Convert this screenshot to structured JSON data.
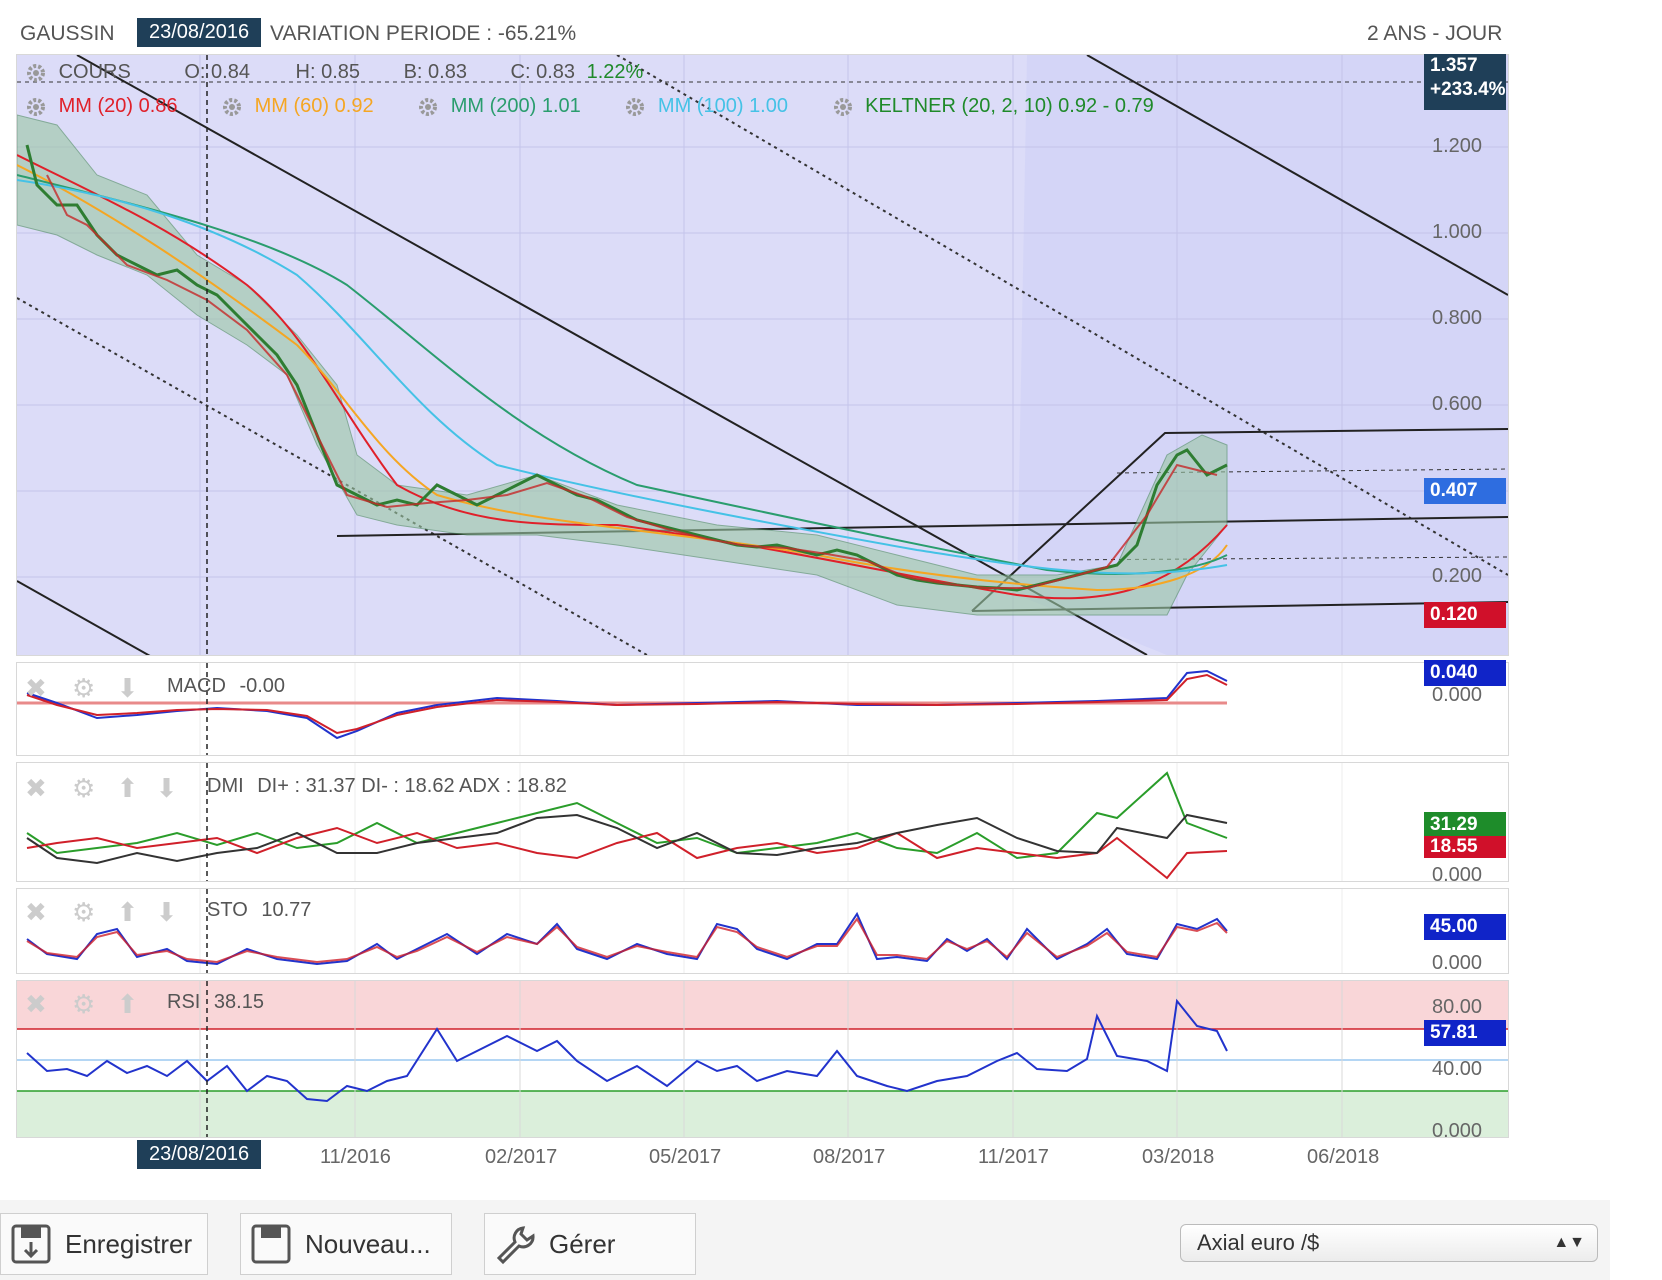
{
  "header": {
    "symbol": "GAUSSIN",
    "cursor_date": "23/08/2016",
    "variation": "VARIATION PERIODE : -65.21%",
    "period": "2 ANS - JOUR"
  },
  "price_panel": {
    "cours": {
      "label": "COURS",
      "o": "O: 0.84",
      "h": "H: 0.85",
      "b": "B: 0.83",
      "c": "C: 0.83",
      "chg": "1.22%"
    },
    "indicators": [
      {
        "label": "MM (20)",
        "value": "0.86",
        "color": "#e0202a"
      },
      {
        "label": "MM (60)",
        "value": "0.92",
        "color": "#f5a623"
      },
      {
        "label": "MM (200)",
        "value": "1.01",
        "color": "#2a9d6e"
      },
      {
        "label": "MM (100)",
        "value": "1.00",
        "color": "#45c2e6"
      },
      {
        "label": "KELTNER (20, 2, 10)",
        "value": "0.92 - 0.79",
        "color": "#1f8a2a"
      }
    ],
    "y_ticks": [
      "1.200",
      "1.000",
      "0.800",
      "0.600",
      "0.200"
    ],
    "tags": [
      {
        "text": "1.357",
        "sub": "+233.4%",
        "color": "#1f3f58"
      },
      {
        "text": "0.407",
        "color": "#2e6de0"
      },
      {
        "text": "0.120",
        "color": "#d0102a"
      }
    ]
  },
  "macd": {
    "label": "MACD",
    "value": "-0.00",
    "tag": "0.040",
    "zero": "0.000"
  },
  "dmi": {
    "label": "DMI",
    "value": "DI+ : 31.37 DI- : 18.62 ADX : 18.82",
    "tag_green": "31.29",
    "tag_red": "18.55",
    "zero": "0.000"
  },
  "sto": {
    "label": "STO",
    "value": "10.77",
    "tag": "45.00",
    "zero": "0.000"
  },
  "rsi": {
    "label": "RSI",
    "value": "38.15",
    "ticks": [
      "80.00",
      "40.00",
      "0.000"
    ],
    "tag": "57.81"
  },
  "x_axis": {
    "cursor_date": "23/08/2016",
    "labels": [
      "11/2016",
      "02/2017",
      "05/2017",
      "08/2017",
      "11/2017",
      "03/2018",
      "06/2018"
    ]
  },
  "toolbar": {
    "save": "Enregistrer",
    "new": "Nouveau...",
    "manage": "Gérer",
    "axis_select": "Axial euro /$"
  },
  "colors": {
    "channel_fill": "#dcdcf8",
    "rsi_overbought": "#f9d6d8",
    "rsi_oversold": "#dbefdb",
    "tag_blue": "#1024c8",
    "tag_green": "#1e8c2a",
    "tag_red": "#d0102a"
  }
}
